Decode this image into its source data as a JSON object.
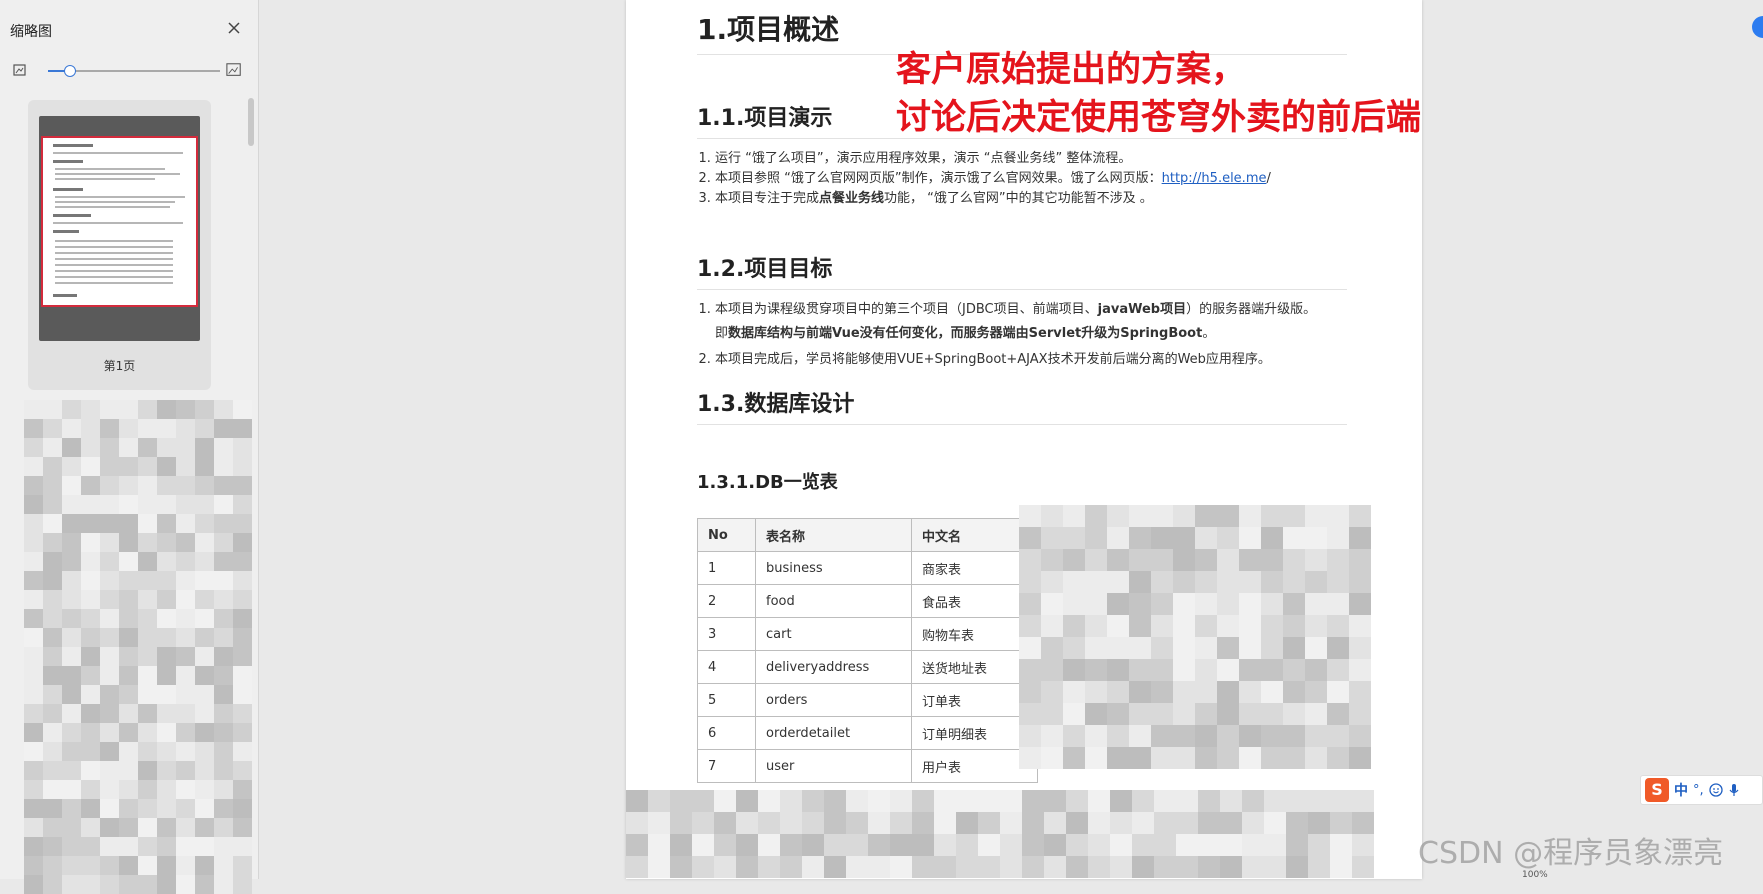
{
  "sidebar": {
    "title": "缩略图",
    "zoom_level": 0.12,
    "thumbnail_label": "第1页"
  },
  "document": {
    "h1": "1.项目概述",
    "s11": {
      "title": "1.1.项目演示",
      "items": [
        {
          "text": "运行 “饿了么项目”，演示应用程序效果，演示 “点餐业务线” 整体流程。"
        },
        {
          "pre": "本项目参照 “饿了么官网网页版”制作，演示饿了么官网效果。饿了么网页版：",
          "link": "http://h5.ele.me",
          "post": "/"
        },
        {
          "pre": "本项目专注于完成",
          "bold": "点餐业务线",
          "post": "功能， “饿了么官网”中的其它功能暂不涉及 。"
        }
      ]
    },
    "s12": {
      "title": "1.2.项目目标",
      "item1_pre": "本项目为课程级贯穿项目中的第三个项目（JDBC项目、前端项目、",
      "item1_bold": "javaWeb项目",
      "item1_post": "）的服务器端升级版。",
      "item1_sub_pre": "即",
      "item1_sub_bold": "数据库结构与前端Vue没有任何变化，而服务器端由Servlet升级为SpringBoot",
      "item1_sub_post": "。",
      "item2": "本项目完成后，学员将能够使用VUE+SpringBoot+AJAX技术开发前后端分离的Web应用程序。"
    },
    "s13_title": "1.3.数据库设计",
    "s131_title": "1.3.1.DB一览表",
    "table": {
      "headers": [
        "No",
        "表名称",
        "中文名"
      ],
      "rows": [
        [
          "1",
          "business",
          "商家表"
        ],
        [
          "2",
          "food",
          "食品表"
        ],
        [
          "3",
          "cart",
          "购物车表"
        ],
        [
          "4",
          "deliveryaddress",
          "送货地址表"
        ],
        [
          "5",
          "orders",
          "订单表"
        ],
        [
          "6",
          "orderdetailet",
          "订单明细表"
        ],
        [
          "7",
          "user",
          "用户表"
        ]
      ]
    }
  },
  "annotation": {
    "line1": "客户原始提出的方案，",
    "line2": "讨论后决定使用苍穹外卖的前后端"
  },
  "ime": {
    "logo": "S",
    "label": "中",
    "extra": "°,"
  },
  "watermark": "CSDN @程序员象漂亮",
  "status": "100%",
  "colors": {
    "annotation": "#e4141c",
    "link": "#1f5fc2",
    "thumb_border": "#d32b3c",
    "slider": "#3a78d6"
  }
}
